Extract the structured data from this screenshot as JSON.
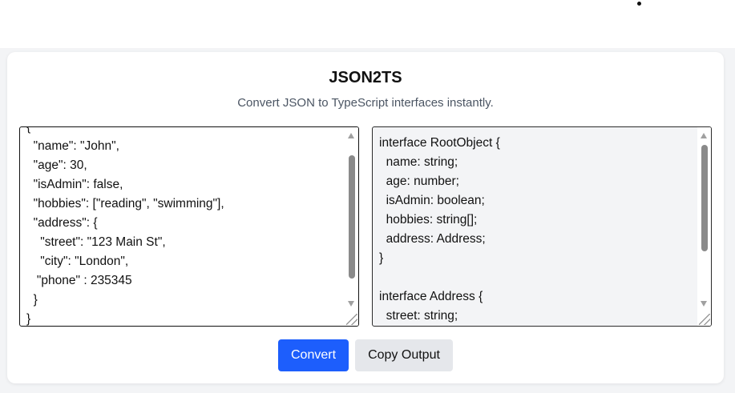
{
  "app": {
    "title": "JSON2TS",
    "subtitle": "Convert JSON to TypeScript interfaces instantly."
  },
  "input": {
    "value": "{\n  \"name\": \"John\",\n  \"age\": 30,\n  \"isAdmin\": false,\n  \"hobbies\": [\"reading\", \"swimming\"],\n  \"address\": {\n    \"street\": \"123 Main St\",\n    \"city\": \"London\",\n   \"phone\" : 235345\n  }\n}"
  },
  "output": {
    "value": "interface RootObject {\n  name: string;\n  age: number;\n  isAdmin: boolean;\n  hobbies: string[];\n  address: Address;\n}\n\ninterface Address {\n  street: string;\n  city: string;\n  phone: number;\n}"
  },
  "buttons": {
    "convert_label": "Convert",
    "copy_label": "Copy Output"
  },
  "colors": {
    "accent": "#1d5efc",
    "output_background": "#f3f4f6",
    "secondary_button": "#e5e7eb"
  }
}
